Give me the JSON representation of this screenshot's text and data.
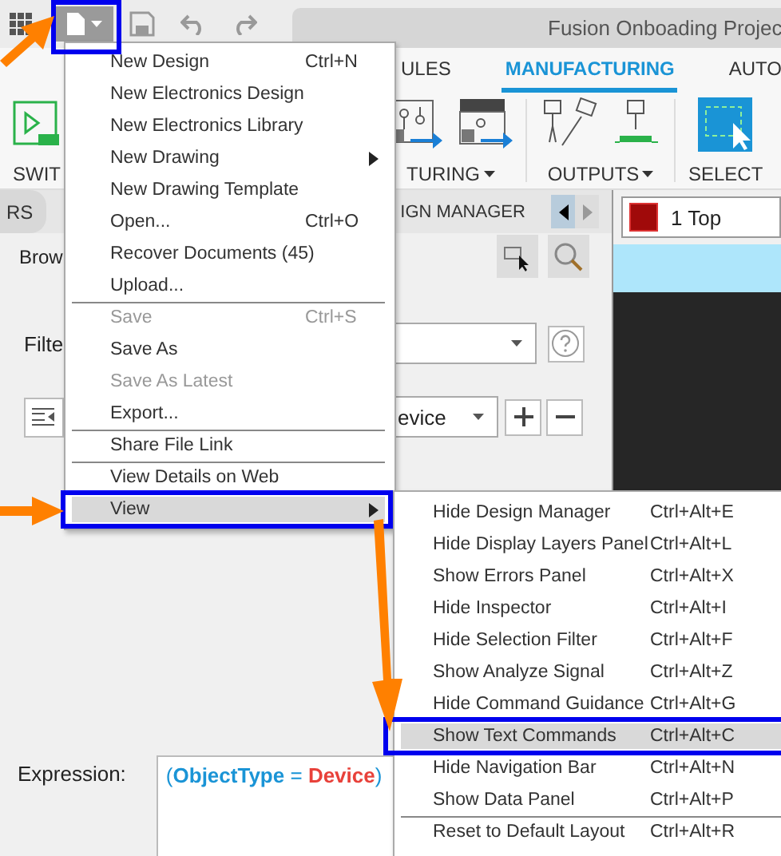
{
  "toolbar": {
    "document_tab": "Fusion Onboading Projec"
  },
  "ribbon": {
    "tabs": [
      {
        "label": "ULES",
        "selected": false
      },
      {
        "label": "MANUFACTURING",
        "selected": true
      },
      {
        "label": "AUTO",
        "selected": false
      }
    ],
    "groups": [
      {
        "label": "SWIT",
        "dropdown": false
      },
      {
        "label": "TURING",
        "dropdown": true
      },
      {
        "label": "OUTPUTS",
        "dropdown": true
      },
      {
        "label": "SELECT",
        "dropdown": false
      }
    ]
  },
  "panel": {
    "tabs": [
      {
        "label": "RS"
      },
      {
        "label": "IGN MANAGER"
      }
    ],
    "browse_label": "Brow",
    "filter_label": "Filte",
    "object_dropdown": "evice",
    "expression_label": "Expression:",
    "expression": [
      {
        "text": "(",
        "kind": "plain"
      },
      {
        "text": "ObjectType",
        "kind": "field"
      },
      {
        "text": " = ",
        "kind": "plain"
      },
      {
        "text": "Device",
        "kind": "value"
      },
      {
        "text": ")",
        "kind": "plain"
      }
    ]
  },
  "layer": {
    "name": "1 Top",
    "color": "#a00a0a"
  },
  "file_menu": {
    "items": [
      {
        "label": "New Design",
        "shortcut": "Ctrl+N",
        "disabled": false,
        "selected": false,
        "submenu": false,
        "separator_above": false
      },
      {
        "label": "New Electronics Design",
        "disabled": false,
        "selected": false,
        "submenu": false,
        "separator_above": false
      },
      {
        "label": "New Electronics Library",
        "disabled": false,
        "selected": false,
        "submenu": false,
        "separator_above": false
      },
      {
        "label": "New Drawing",
        "disabled": false,
        "selected": false,
        "submenu": true,
        "separator_above": false
      },
      {
        "label": "New Drawing Template",
        "disabled": false,
        "selected": false,
        "submenu": false,
        "separator_above": false
      },
      {
        "label": "Open...",
        "shortcut": "Ctrl+O",
        "disabled": false,
        "selected": false,
        "submenu": false,
        "separator_above": false
      },
      {
        "label": "Recover Documents (45)",
        "disabled": false,
        "selected": false,
        "submenu": false,
        "separator_above": false
      },
      {
        "label": "Upload...",
        "disabled": false,
        "selected": false,
        "submenu": false,
        "separator_above": false
      },
      {
        "label": "Save",
        "shortcut": "Ctrl+S",
        "disabled": true,
        "selected": false,
        "submenu": false,
        "separator_above": true
      },
      {
        "label": "Save As",
        "disabled": false,
        "selected": false,
        "submenu": false,
        "separator_above": false
      },
      {
        "label": "Save As Latest",
        "disabled": true,
        "selected": false,
        "submenu": false,
        "separator_above": false
      },
      {
        "label": "Export...",
        "disabled": false,
        "selected": false,
        "submenu": false,
        "separator_above": false
      },
      {
        "label": "Share File Link",
        "disabled": false,
        "selected": false,
        "submenu": false,
        "separator_above": true
      },
      {
        "label": "View Details on Web",
        "disabled": false,
        "selected": false,
        "submenu": false,
        "separator_above": true
      },
      {
        "label": "View",
        "disabled": false,
        "selected": true,
        "submenu": true,
        "separator_above": false
      }
    ]
  },
  "view_submenu": {
    "items": [
      {
        "label": "Hide Design Manager",
        "shortcut": "Ctrl+Alt+E",
        "selected": false,
        "separator_above": false
      },
      {
        "label": "Hide Display Layers Panel",
        "shortcut": "Ctrl+Alt+L",
        "selected": false,
        "separator_above": false
      },
      {
        "label": "Show Errors Panel",
        "shortcut": "Ctrl+Alt+X",
        "selected": false,
        "separator_above": false
      },
      {
        "label": "Hide Inspector",
        "shortcut": "Ctrl+Alt+I",
        "selected": false,
        "separator_above": false
      },
      {
        "label": "Hide Selection Filter",
        "shortcut": "Ctrl+Alt+F",
        "selected": false,
        "separator_above": false
      },
      {
        "label": "Show Analyze Signal",
        "shortcut": "Ctrl+Alt+Z",
        "selected": false,
        "separator_above": false
      },
      {
        "label": "Hide Command Guidance",
        "shortcut": "Ctrl+Alt+G",
        "selected": false,
        "separator_above": false
      },
      {
        "label": "Show Text Commands",
        "shortcut": "Ctrl+Alt+C",
        "selected": true,
        "separator_above": false
      },
      {
        "label": "Hide Navigation Bar",
        "shortcut": "Ctrl+Alt+N",
        "selected": false,
        "separator_above": false
      },
      {
        "label": "Show Data Panel",
        "shortcut": "Ctrl+Alt+P",
        "selected": false,
        "separator_above": false
      },
      {
        "label": "Reset to Default Layout",
        "shortcut": "Ctrl+Alt+R",
        "selected": false,
        "separator_above": true
      }
    ]
  }
}
